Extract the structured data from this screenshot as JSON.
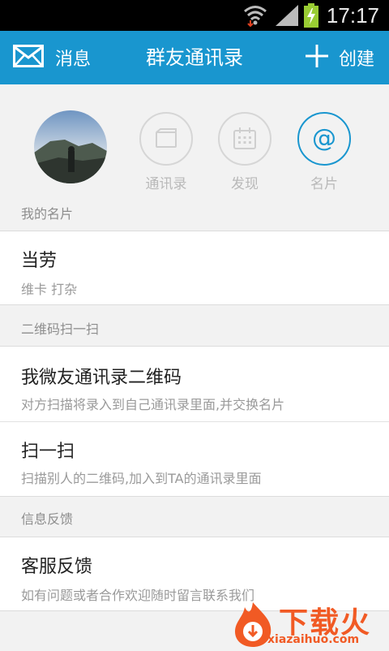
{
  "status_bar": {
    "time": "17:17"
  },
  "header": {
    "left_label": "消息",
    "title": "群友通讯录",
    "right_label": "创建",
    "color": "#1996cf"
  },
  "quick_actions": [
    {
      "label": "通讯录",
      "icon": "contacts-card-icon",
      "active": false
    },
    {
      "label": "发现",
      "icon": "calendar-icon",
      "active": false
    },
    {
      "label": "名片",
      "icon": "at-sign-icon",
      "active": true
    }
  ],
  "sections": {
    "my_card": {
      "header": "我的名片",
      "name": "当劳",
      "detail": "维卡 打杂"
    },
    "qr": {
      "header": "二维码扫一扫",
      "items": [
        {
          "title": "我微友通讯录二维码",
          "subtitle": "对方扫描将录入到自己通讯录里面,并交换名片"
        },
        {
          "title": "扫一扫",
          "subtitle": "扫描别人的二维码,加入到TA的通讯录里面"
        }
      ]
    },
    "feedback": {
      "header": "信息反馈",
      "title": "客服反馈",
      "subtitle": "如有问题或者合作欢迎随时留言联系我们"
    }
  },
  "watermark": {
    "text": "下载火",
    "url": "xiazaihuo.com"
  }
}
